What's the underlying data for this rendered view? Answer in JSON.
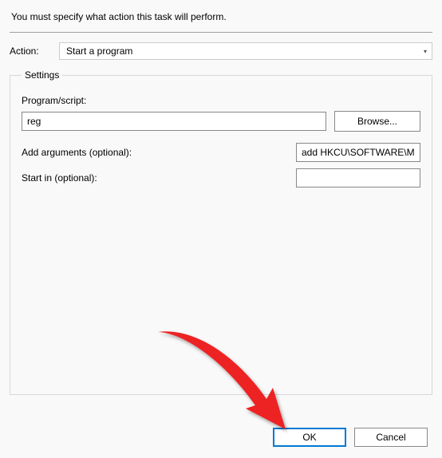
{
  "instruction": "You must specify what action this task will perform.",
  "action": {
    "label": "Action:",
    "selected": "Start a program"
  },
  "settings": {
    "legend": "Settings",
    "program_label": "Program/script:",
    "program_value": "reg",
    "browse_label": "Browse...",
    "arguments_label": "Add arguments (optional):",
    "arguments_value": "add HKCU\\SOFTWARE\\M",
    "startin_label": "Start in (optional):",
    "startin_value": ""
  },
  "buttons": {
    "ok": "OK",
    "cancel": "Cancel"
  }
}
